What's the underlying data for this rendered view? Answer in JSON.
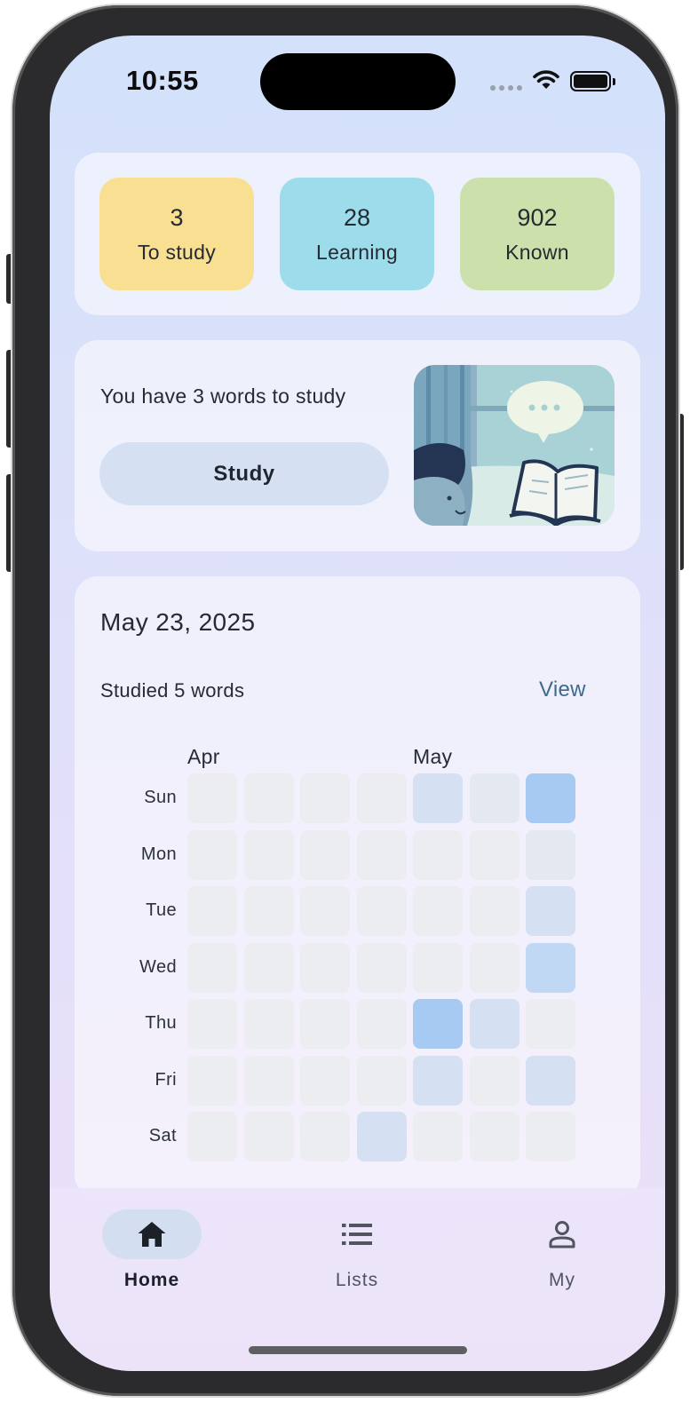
{
  "status_bar": {
    "time": "10:55"
  },
  "stats": [
    {
      "value": "3",
      "label": "To study",
      "color": "#f8df92"
    },
    {
      "value": "28",
      "label": "Learning",
      "color": "#9ddcea"
    },
    {
      "value": "902",
      "label": "Known",
      "color": "#cce0ac"
    }
  ],
  "study_card": {
    "message": "You have 3 words to study",
    "button_label": "Study"
  },
  "activity": {
    "date": "May 23, 2025",
    "summary": "Studied 5 words",
    "view_label": "View",
    "months": [
      "Apr",
      "May"
    ],
    "days": [
      "Sun",
      "Mon",
      "Tue",
      "Wed",
      "Thu",
      "Fri",
      "Sat"
    ],
    "heatmap_levels": [
      [
        0,
        0,
        0,
        0,
        2,
        1,
        4
      ],
      [
        0,
        0,
        0,
        0,
        0,
        0,
        1
      ],
      [
        0,
        0,
        0,
        0,
        0,
        0,
        2
      ],
      [
        0,
        0,
        0,
        0,
        0,
        0,
        3
      ],
      [
        0,
        0,
        0,
        0,
        4,
        2,
        0
      ],
      [
        0,
        0,
        0,
        0,
        2,
        0,
        2
      ],
      [
        0,
        0,
        0,
        2,
        0,
        0,
        0
      ]
    ],
    "level_colors": [
      "#ebedf1",
      "#e3e8f1",
      "#d5e1f2",
      "#c0d8f3",
      "#a7caf3"
    ]
  },
  "tabs": [
    {
      "label": "Home",
      "icon": "home-icon",
      "active": true
    },
    {
      "label": "Lists",
      "icon": "list-icon",
      "active": false
    },
    {
      "label": "My",
      "icon": "person-icon",
      "active": false
    }
  ]
}
